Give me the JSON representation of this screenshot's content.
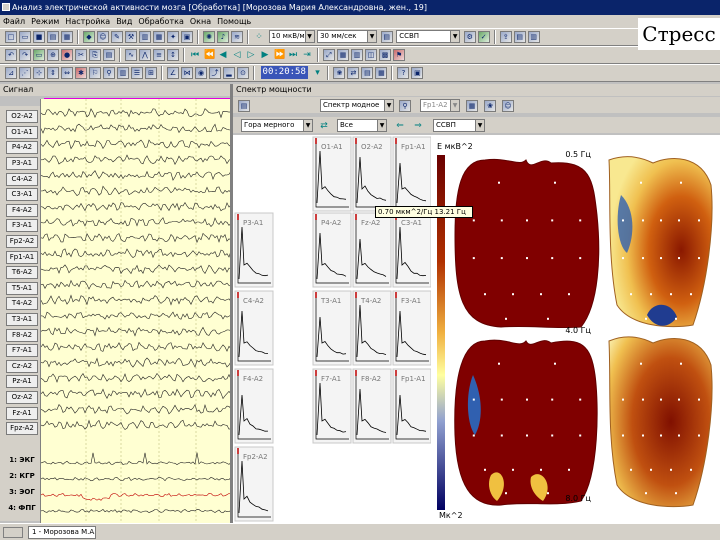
{
  "window": {
    "title": "Анализ электрической активности мозга  [Обработка]  [Морозова Мария Александровна, жен., 19]"
  },
  "overlay_label": "Стресс",
  "menu": [
    "Файл",
    "Режим",
    "Настройка",
    "Вид",
    "Обработка",
    "Окна",
    "Помощь"
  ],
  "toolbar": {
    "sensitivity": "10 мкВ/мм",
    "speed": "30 мм/сек",
    "montage": "ССВП",
    "time_display": "00:20:58"
  },
  "left_panel": {
    "title": "Сигнал",
    "channels": [
      "O2-A2",
      "O1-A1",
      "P4-A2",
      "P3-A1",
      "C4-A2",
      "C3-A1",
      "F4-A2",
      "F3-A1",
      "Fp2-A2",
      "Fp1-A1",
      "T6-A2",
      "T5-A1",
      "T4-A2",
      "T3-A1",
      "F8-A2",
      "F7-A1",
      "Cz-A2",
      "Pz-A1",
      "Oz-A2",
      "Fz-A1",
      "Fpz-A2",
      "1: ЭКГ",
      "2: КГР",
      "3: ЭОГ",
      "4: ФПГ"
    ],
    "bold_channels": [
      "1: ЭКГ",
      "2: КГР",
      "3: ЭОГ",
      "4: ФПГ"
    ]
  },
  "spectrum_panel": {
    "title": "Спектр мощности",
    "view_mode": "Спектр модное",
    "ref_mode": "Fp1-A2",
    "grouping": "Гора мерного",
    "selection": "Все",
    "montage": "ССВП",
    "tooltip": "0.70 мкм^2/Гц 13.21 Гц",
    "cell_labels": [
      "O1-A1",
      "O2-A2",
      "Fp1-A1",
      "P3-A1",
      "P4-A2",
      "Fz-A2",
      "C3-A1",
      "C4-A2",
      "T3-A1",
      "T4-A2",
      "F3-A1",
      "F4-A2",
      "F7-A1",
      "F8-A2",
      "Fp1-A1",
      "Fp2-A2"
    ]
  },
  "topo": {
    "scale_top": "E мкВ^2",
    "scale_bottom": "Мк^2",
    "freq_labels": [
      "0.5 Гц",
      "4.0 Гц",
      "8.0 Гц"
    ]
  },
  "taskbar": {
    "window_label": "1 - Морозова М.А."
  }
}
